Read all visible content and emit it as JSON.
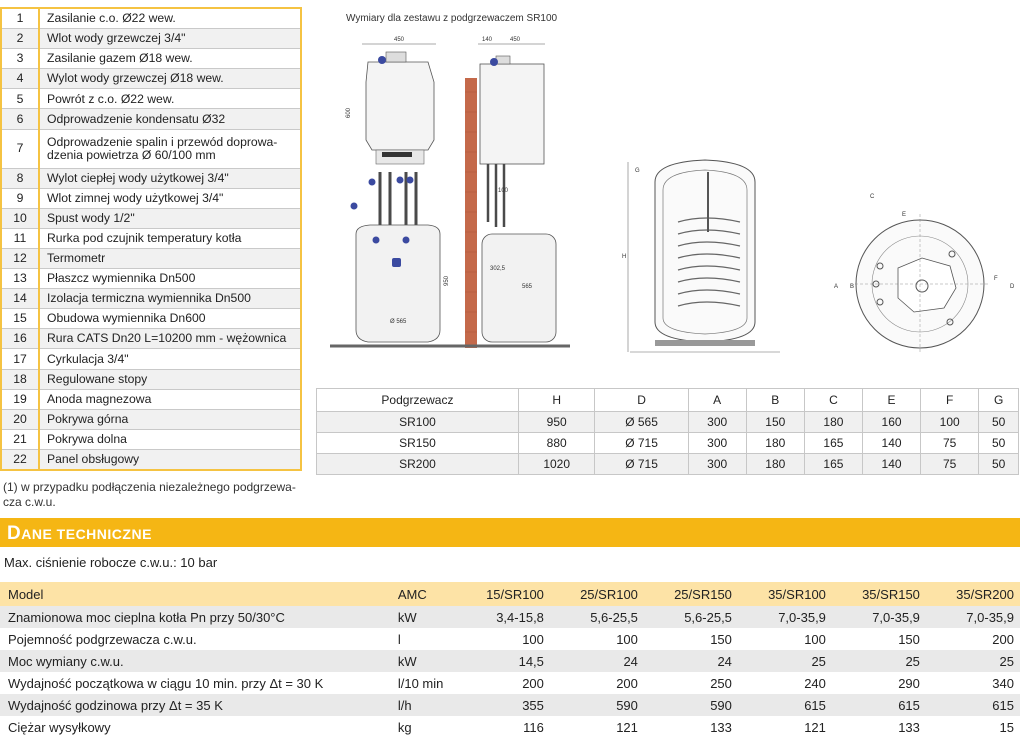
{
  "legend": [
    {
      "n": "1",
      "t": "Zasilanie c.o. Ø22 wew."
    },
    {
      "n": "2",
      "t": "Wlot wody grzewczej 3/4\""
    },
    {
      "n": "3",
      "t": "Zasilanie gazem Ø18 wew."
    },
    {
      "n": "4",
      "t": "Wylot wody grzewczej Ø18 wew."
    },
    {
      "n": "5",
      "t": "Powrót z c.o. Ø22 wew."
    },
    {
      "n": "6",
      "t": "Odprowadzenie kondensatu Ø32"
    },
    {
      "n": "7",
      "t": "Odprowadzenie spalin i przewód doprowa-dzenia powietrza Ø 60/100 mm"
    },
    {
      "n": "8",
      "t": "Wylot ciepłej wody użytkowej 3/4\""
    },
    {
      "n": "9",
      "t": "Wlot zimnej wody użytkowej 3/4\""
    },
    {
      "n": "10",
      "t": "Spust wody 1/2\""
    },
    {
      "n": "11",
      "t": "Rurka pod czujnik temperatury kotła"
    },
    {
      "n": "12",
      "t": "Termometr"
    },
    {
      "n": "13",
      "t": "Płaszcz wymiennika Dn500"
    },
    {
      "n": "14",
      "t": "Izolacja termiczna wymiennika Dn500"
    },
    {
      "n": "15",
      "t": "Obudowa wymiennika Dn600"
    },
    {
      "n": "16",
      "t": "Rura CATS Dn20 L=10200 mm - wężownica"
    },
    {
      "n": "17",
      "t": "Cyrkulacja 3/4\""
    },
    {
      "n": "18",
      "t": "Regulowane stopy"
    },
    {
      "n": "19",
      "t": "Anoda magnezowa"
    },
    {
      "n": "20",
      "t": "Pokrywa górna"
    },
    {
      "n": "21",
      "t": "Pokrywa dolna"
    },
    {
      "n": "22",
      "t": "Panel obsługowy"
    }
  ],
  "footnote": "(1) w przypadku podłączenia niezależnego podgrzewa-cza c.w.u.",
  "drawing": {
    "title": "Wymiary dla zestawu z podgrzewaczem SR100",
    "dims": [
      "450",
      "140",
      "450",
      "600",
      "950",
      "302,5",
      "565",
      "Ø 565",
      "100",
      "G",
      "H",
      "C",
      "E",
      "A",
      "B",
      "F",
      "D",
      "45"
    ],
    "callouts": [
      "1",
      "2",
      "3",
      "4",
      "5",
      "6",
      "7",
      "8",
      "9",
      "10",
      "11",
      "12",
      "13",
      "14",
      "15",
      "16",
      "17",
      "18",
      "19",
      "20",
      "21",
      "22"
    ]
  },
  "dims_table": {
    "headers": [
      "Podgrzewacz",
      "H",
      "D",
      "A",
      "B",
      "C",
      "E",
      "F",
      "G"
    ],
    "rows": [
      [
        "SR100",
        "950",
        "Ø 565",
        "300",
        "150",
        "180",
        "160",
        "100",
        "50"
      ],
      [
        "SR150",
        "880",
        "Ø 715",
        "300",
        "180",
        "165",
        "140",
        "75",
        "50"
      ],
      [
        "SR200",
        "1020",
        "Ø 715",
        "300",
        "180",
        "165",
        "140",
        "75",
        "50"
      ]
    ]
  },
  "section": {
    "title": "Dane techniczne"
  },
  "pressure": "Max. ciśnienie robocze c.w.u.: 10 bar",
  "tech": {
    "header": {
      "label": "Model",
      "unit": "AMC",
      "cols": [
        "15/SR100",
        "25/SR100",
        "25/SR150",
        "35/SR100",
        "35/SR150",
        "35/SR200"
      ]
    },
    "rows": [
      {
        "label": "Znamionowa moc cieplna kotła Pn przy 50/30°C",
        "unit": "kW",
        "vals": [
          "3,4-15,8",
          "5,6-25,5",
          "5,6-25,5",
          "7,0-35,9",
          "7,0-35,9",
          "7,0-35,9"
        ]
      },
      {
        "label": "Pojemność podgrzewacza c.w.u.",
        "unit": "l",
        "vals": [
          "100",
          "100",
          "150",
          "100",
          "150",
          "200"
        ]
      },
      {
        "label": "Moc wymiany c.w.u.",
        "unit": "kW",
        "vals": [
          "14,5",
          "24",
          "24",
          "25",
          "25",
          "25"
        ]
      },
      {
        "label": "Wydajność początkowa w ciągu 10 min. przy Δt = 30 K",
        "unit": "l/10 min",
        "vals": [
          "200",
          "200",
          "250",
          "240",
          "290",
          "340"
        ]
      },
      {
        "label": "Wydajność godzinowa przy Δt = 35 K",
        "unit": "l/h",
        "vals": [
          "355",
          "590",
          "590",
          "615",
          "615",
          "615"
        ]
      },
      {
        "label": "Ciężar wysyłkowy",
        "unit": "kg",
        "vals": [
          "116",
          "121",
          "133",
          "121",
          "133",
          "15"
        ]
      }
    ]
  },
  "colors": {
    "accent": "#f5b614",
    "header_bg": "#fde3a6",
    "legend_border": "#f5c342",
    "marker": "#3b4aa0",
    "wall": "#c4694a"
  }
}
